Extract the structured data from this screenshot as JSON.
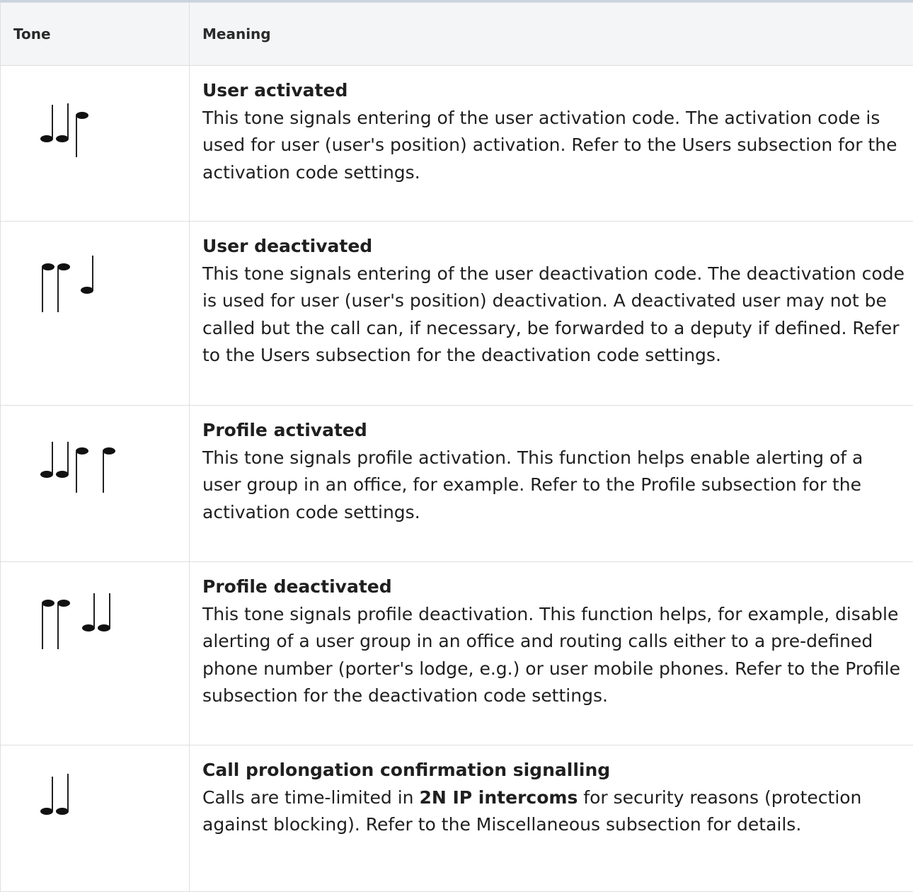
{
  "table": {
    "headers": {
      "tone": "Tone",
      "meaning": "Meaning"
    },
    "rows": [
      {
        "tone_icon": "tone-user-activated-icon",
        "title": "User activated",
        "description": "This tone signals entering of the user activation code. The activation code is used for user (user's position) activation. Refer to the Users subsection for the activation code settings."
      },
      {
        "tone_icon": "tone-user-deactivated-icon",
        "title": "User deactivated",
        "description": "This tone signals entering of the user deactivation code. The deactivation code is used for user (user's position) deactivation. A deactivated user may not be called but the call can, if necessary, be forwarded to a deputy if defined. Refer to the Users subsection for the deactivation code settings."
      },
      {
        "tone_icon": "tone-profile-activated-icon",
        "title": "Profile activated",
        "description": "This tone signals profile activation. This function helps enable alerting of a user group in an office, for example. Refer to the Profile subsection for the activation code settings."
      },
      {
        "tone_icon": "tone-profile-deactivated-icon",
        "title": "Profile deactivated",
        "description": "This tone signals profile deactivation. This function helps, for example, disable alerting of a user group in an office and routing calls either to a pre-defined phone number (porter's lodge, e.g.) or user mobile phones. Refer to the Profile subsection for the deactivation code settings."
      },
      {
        "tone_icon": "tone-call-prolongation-icon",
        "title": "Call prolongation confirmation signalling",
        "description_before": "Calls are time-limited in ",
        "description_bold": "2N IP intercoms",
        "description_after": " for security reasons (protection against blocking). Refer to the Miscellaneous subsection for details."
      }
    ]
  }
}
